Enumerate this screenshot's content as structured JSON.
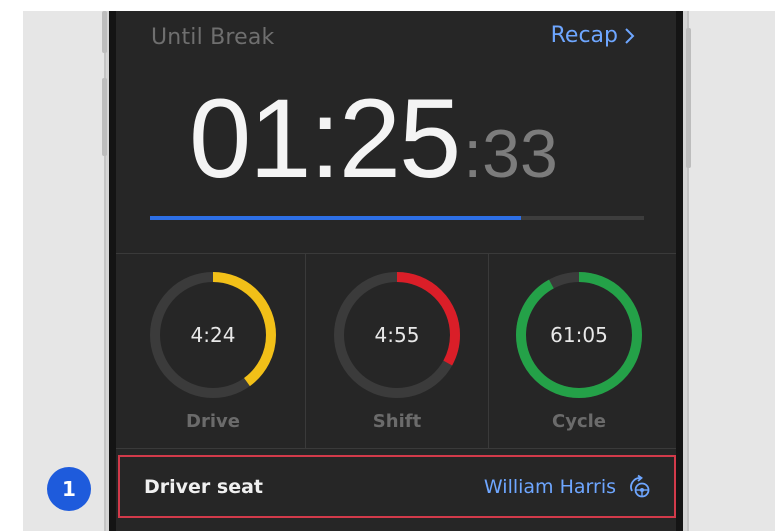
{
  "header": {
    "label": "Until Break",
    "recap_label": "Recap",
    "recap_icon": "chevron-right-icon"
  },
  "timer": {
    "main": "01:25",
    "seconds": ":33",
    "progress": 0.75,
    "progress_color": "#2d6fe6"
  },
  "gauges": [
    {
      "value": "4:24",
      "label": "Drive",
      "fraction": 0.4,
      "color": "#f2c018"
    },
    {
      "value": "4:55",
      "label": "Shift",
      "fraction": 0.33,
      "color": "#da1e28"
    },
    {
      "value": "61:05",
      "label": "Cycle",
      "fraction": 0.92,
      "color": "#24a148"
    }
  ],
  "driver": {
    "label": "Driver seat",
    "name": "William Harris",
    "swap_icon": "swap-driver-icon"
  },
  "annotation": {
    "step_number": "1",
    "highlight_color": "#d23a4a",
    "badge_color": "#1e5bdc"
  }
}
